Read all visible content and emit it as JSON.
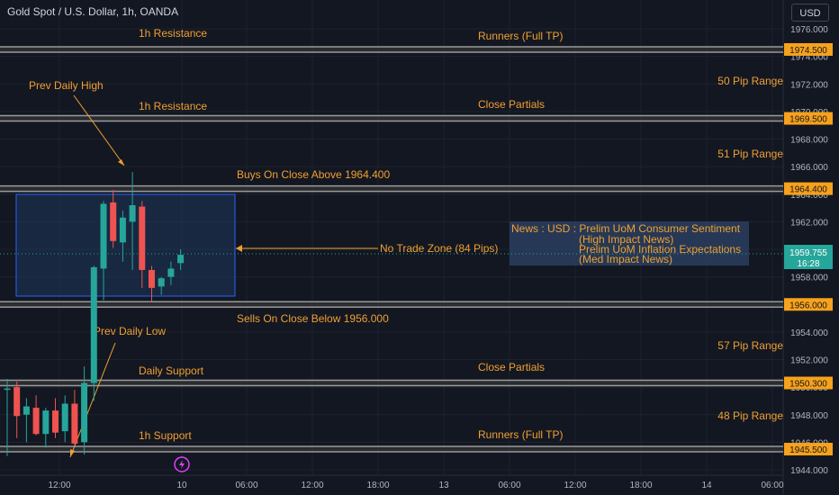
{
  "header": {
    "symbol_title": "Gold Spot / U.S. Dollar, 1h, OANDA",
    "currency_button": "USD"
  },
  "colors": {
    "background": "#131722",
    "up": "#26a69a",
    "down": "#ef5350",
    "annotation": "#f0a030",
    "level_label_bg": "#f7a21b",
    "price_label_bg": "#26a69a",
    "zone_fill": "#1e3a5f",
    "zone_border": "#2962ff"
  },
  "chart_data": {
    "type": "candlestick",
    "instrument": "XAUUSD",
    "timeframe": "1h",
    "ylim": [
      1943.8,
      1977.4
    ],
    "y_ticks": [
      "1944.000",
      "1946.000",
      "1948.000",
      "1950.000",
      "1952.000",
      "1954.000",
      "1956.000",
      "1958.000",
      "1960.000",
      "1962.000",
      "1964.000",
      "1966.000",
      "1968.000",
      "1970.000",
      "1972.000",
      "1974.000",
      "1976.000"
    ],
    "x_ticks": [
      "12:00",
      "10",
      "06:00",
      "12:00",
      "18:00",
      "13",
      "06:00",
      "12:00",
      "18:00",
      "14",
      "06:00"
    ],
    "candles": [
      {
        "o": 1949.8,
        "h": 1950.6,
        "l": 1945.0,
        "c": 1949.9
      },
      {
        "o": 1950.0,
        "h": 1950.4,
        "l": 1946.3,
        "c": 1947.9
      },
      {
        "o": 1948.0,
        "h": 1949.2,
        "l": 1946.0,
        "c": 1948.6
      },
      {
        "o": 1948.5,
        "h": 1949.4,
        "l": 1946.5,
        "c": 1946.6
      },
      {
        "o": 1946.6,
        "h": 1948.5,
        "l": 1945.6,
        "c": 1948.3
      },
      {
        "o": 1948.3,
        "h": 1949.2,
        "l": 1946.3,
        "c": 1946.7
      },
      {
        "o": 1946.8,
        "h": 1949.4,
        "l": 1946.0,
        "c": 1948.8
      },
      {
        "o": 1948.8,
        "h": 1949.8,
        "l": 1945.8,
        "c": 1945.9
      },
      {
        "o": 1946.0,
        "h": 1951.5,
        "l": 1945.1,
        "c": 1950.3
      },
      {
        "o": 1950.3,
        "h": 1958.8,
        "l": 1949.0,
        "c": 1958.7
      },
      {
        "o": 1958.6,
        "h": 1963.5,
        "l": 1956.3,
        "c": 1963.3
      },
      {
        "o": 1963.4,
        "h": 1964.3,
        "l": 1960.1,
        "c": 1960.6
      },
      {
        "o": 1960.5,
        "h": 1962.8,
        "l": 1959.1,
        "c": 1962.3
      },
      {
        "o": 1962.0,
        "h": 1965.6,
        "l": 1958.5,
        "c": 1963.2
      },
      {
        "o": 1963.1,
        "h": 1963.5,
        "l": 1957.2,
        "c": 1958.5
      },
      {
        "o": 1958.5,
        "h": 1958.8,
        "l": 1956.2,
        "c": 1957.2
      },
      {
        "o": 1957.3,
        "h": 1958.0,
        "l": 1956.7,
        "c": 1957.9
      },
      {
        "o": 1958.0,
        "h": 1959.1,
        "l": 1957.4,
        "c": 1958.6
      },
      {
        "o": 1959.0,
        "h": 1960.0,
        "l": 1958.5,
        "c": 1959.6
      }
    ],
    "horizontal_levels": [
      {
        "price": 1974.5,
        "label": "1974.500",
        "left_text": "1h Resistance",
        "right_text": "Runners (Full TP)"
      },
      {
        "price": 1969.5,
        "label": "1969.500",
        "left_text": "1h Resistance",
        "right_text": "Close Partials"
      },
      {
        "price": 1964.4,
        "label": "1964.400",
        "left_text": "",
        "right_text": "Buys On Close Above 1964.400"
      },
      {
        "price": 1956.0,
        "label": "1956.000",
        "left_text": "",
        "right_text": "Sells On Close Below 1956.000"
      },
      {
        "price": 1950.3,
        "label": "1950.300",
        "left_text": "Daily Support",
        "right_text": "Close Partials"
      },
      {
        "price": 1945.5,
        "label": "1945.500",
        "left_text": "1h Support",
        "right_text": "Runners (Full TP)"
      }
    ],
    "pip_ranges": [
      "50 Pip Range",
      "51 Pip Range",
      "57 Pip Range",
      "48 Pip Range"
    ],
    "current_price": "1959.755",
    "countdown": "16:28",
    "no_trade_zone": "No Trade Zone (84 Pips)",
    "prev_daily_high": "Prev Daily High",
    "prev_daily_low": "Prev Daily Low",
    "news": [
      "News : USD : Prelim UoM Consumer Sentiment",
      "(High Impact News)",
      "Prelim UoM Inflation Expectations",
      "(Med Impact News)"
    ]
  }
}
